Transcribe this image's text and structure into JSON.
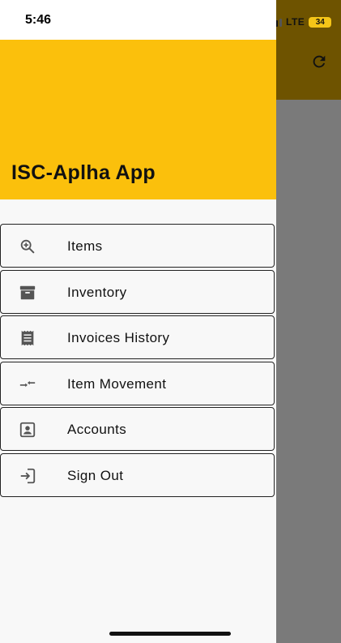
{
  "status_bar": {
    "time": "5:46",
    "network": "LTE",
    "battery": "34"
  },
  "drawer": {
    "title": "ISC-Aplha App",
    "items": [
      {
        "label": "Items",
        "icon": "zoom-in-icon"
      },
      {
        "label": "Inventory",
        "icon": "archive-icon"
      },
      {
        "label": "Invoices History",
        "icon": "receipt-icon"
      },
      {
        "label": "Item Movement",
        "icon": "swap-arrows-icon"
      },
      {
        "label": "Accounts",
        "icon": "account-box-icon"
      },
      {
        "label": "Sign Out",
        "icon": "login-icon"
      }
    ]
  },
  "background_app": {
    "refresh_icon": "refresh-icon"
  },
  "colors": {
    "header": "#fbc00c",
    "scrim": "#7a7a7a",
    "dimmed_appbar": "#6e5300"
  }
}
